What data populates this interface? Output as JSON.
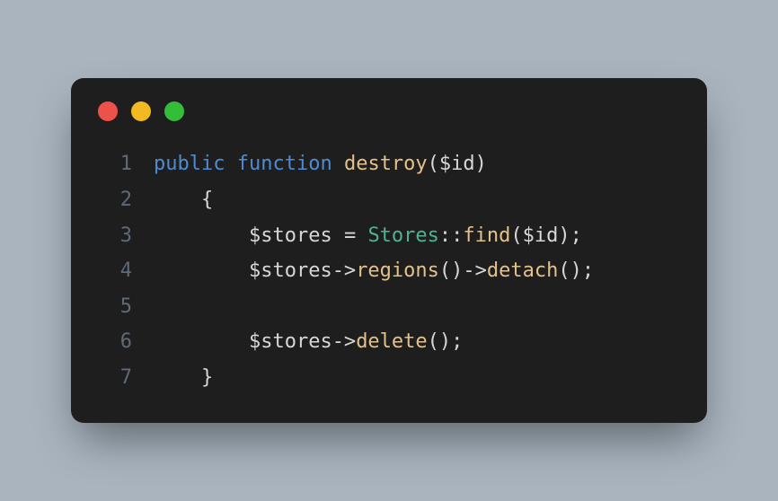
{
  "window": {
    "dots": {
      "red": "#ec5249",
      "yellow": "#f3b921",
      "green": "#33bd39"
    }
  },
  "code": {
    "lines": [
      {
        "n": "1",
        "tokens": [
          {
            "cls": "kw",
            "t": "public"
          },
          {
            "cls": "",
            "t": " "
          },
          {
            "cls": "kw",
            "t": "function"
          },
          {
            "cls": "",
            "t": " "
          },
          {
            "cls": "fn",
            "t": "destroy"
          },
          {
            "cls": "punc",
            "t": "("
          },
          {
            "cls": "var",
            "t": "$id"
          },
          {
            "cls": "punc",
            "t": ")"
          }
        ]
      },
      {
        "n": "2",
        "tokens": [
          {
            "cls": "",
            "t": "    "
          },
          {
            "cls": "punc",
            "t": "{"
          }
        ]
      },
      {
        "n": "3",
        "tokens": [
          {
            "cls": "",
            "t": "        "
          },
          {
            "cls": "var",
            "t": "$stores"
          },
          {
            "cls": "",
            "t": " "
          },
          {
            "cls": "op",
            "t": "="
          },
          {
            "cls": "",
            "t": " "
          },
          {
            "cls": "cls",
            "t": "Stores"
          },
          {
            "cls": "op",
            "t": "::"
          },
          {
            "cls": "fn",
            "t": "find"
          },
          {
            "cls": "punc",
            "t": "("
          },
          {
            "cls": "var",
            "t": "$id"
          },
          {
            "cls": "punc",
            "t": ");"
          }
        ]
      },
      {
        "n": "4",
        "tokens": [
          {
            "cls": "",
            "t": "        "
          },
          {
            "cls": "var",
            "t": "$stores"
          },
          {
            "cls": "op",
            "t": "->"
          },
          {
            "cls": "fn",
            "t": "regions"
          },
          {
            "cls": "punc",
            "t": "()"
          },
          {
            "cls": "op",
            "t": "->"
          },
          {
            "cls": "fn",
            "t": "detach"
          },
          {
            "cls": "punc",
            "t": "();"
          }
        ]
      },
      {
        "n": "5",
        "tokens": []
      },
      {
        "n": "6",
        "tokens": [
          {
            "cls": "",
            "t": "        "
          },
          {
            "cls": "var",
            "t": "$stores"
          },
          {
            "cls": "op",
            "t": "->"
          },
          {
            "cls": "fn",
            "t": "delete"
          },
          {
            "cls": "punc",
            "t": "();"
          }
        ]
      },
      {
        "n": "7",
        "tokens": [
          {
            "cls": "",
            "t": "    "
          },
          {
            "cls": "punc",
            "t": "}"
          }
        ]
      }
    ]
  }
}
